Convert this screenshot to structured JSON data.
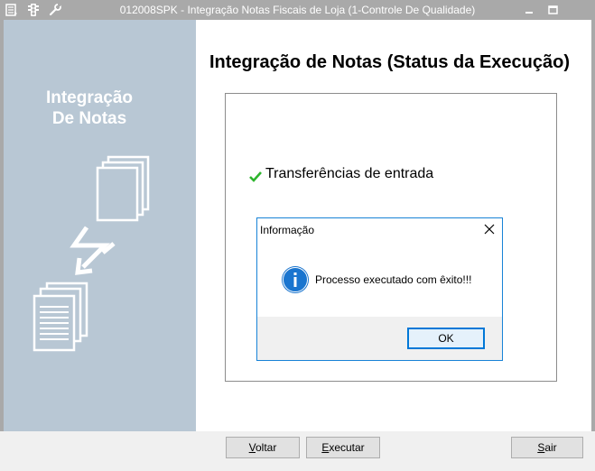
{
  "window": {
    "title": "012008SPK - Integração Notas Fiscais de Loja (1-Controle De Qualidade)"
  },
  "sidepanel": {
    "title_line1": "Integração",
    "title_line2": "De Notas"
  },
  "main": {
    "heading": "Integração de Notas (Status da Execução)",
    "status_items": [
      {
        "label": "Transferências de entrada",
        "icon": "check-icon",
        "icon_color": "#2db52d"
      }
    ]
  },
  "buttons": {
    "voltar": {
      "label": "Voltar",
      "mnemonic": "V",
      "rest": "oltar"
    },
    "executar": {
      "label": "Executar",
      "mnemonic": "E",
      "rest": "xecutar"
    },
    "sair": {
      "label": "Sair",
      "mnemonic": "S",
      "rest": "air"
    }
  },
  "dialog": {
    "title": "Informação",
    "message": "Processo executado com êxito!!!",
    "icon": "info-icon",
    "ok_label": "OK"
  },
  "colors": {
    "titlebar": "#a9a9a9",
    "sidepanel": "#b8c7d4",
    "accent": "#1883d7",
    "info_icon": "#1a75cf"
  }
}
